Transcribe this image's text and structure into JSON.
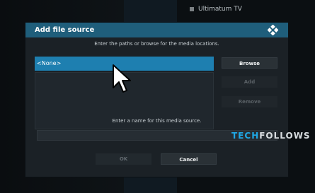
{
  "background": {
    "menu_item": "Ultimatum TV"
  },
  "dialog": {
    "title": "Add file source",
    "paths_instruction": "Enter the paths or browse for the media locations.",
    "paths": [
      "<None>"
    ],
    "buttons": {
      "browse": "Browse",
      "add": "Add",
      "remove": "Remove",
      "ok": "OK",
      "cancel": "Cancel"
    },
    "name_instruction": "Enter a name for this media source.",
    "name_value": ""
  },
  "watermark": {
    "part1": "TECH",
    "part2": "FOLLOWS"
  },
  "colors": {
    "title_bar": "#1f5e7b",
    "selected_row": "#1e7fb0",
    "dialog_bg": "#1b2126",
    "watermark_accent": "#1fa8e6"
  },
  "icons": {
    "logo": "kodi-logo-icon",
    "pointer": "mouse-cursor-icon"
  }
}
